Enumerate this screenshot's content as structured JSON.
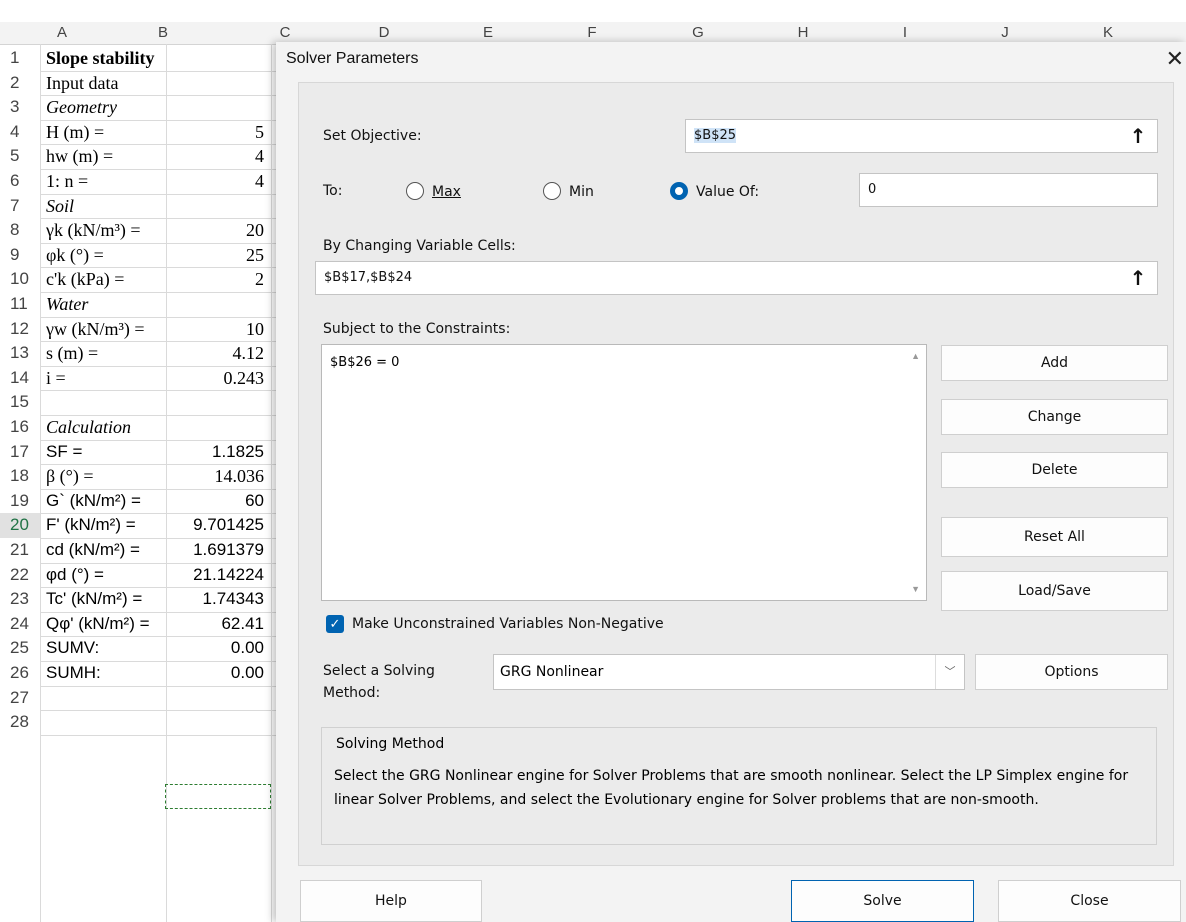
{
  "sheet": {
    "columns": [
      "A",
      "B",
      "C",
      "D",
      "E",
      "F",
      "G",
      "H",
      "I",
      "J",
      "K"
    ],
    "rows": [
      {
        "n": "1",
        "a": "Slope stability",
        "b": "",
        "style": "bold"
      },
      {
        "n": "2",
        "a": "Input data",
        "b": ""
      },
      {
        "n": "3",
        "a": "Geometry",
        "b": "",
        "style": "ital"
      },
      {
        "n": "4",
        "a": "H (m) =",
        "b": "5"
      },
      {
        "n": "5",
        "a": "hw (m) =",
        "b": "4"
      },
      {
        "n": "6",
        "a": "1: n =",
        "b": "4"
      },
      {
        "n": "7",
        "a": "Soil",
        "b": "",
        "style": "ital"
      },
      {
        "n": "8",
        "a": "γk (kN/m³) =",
        "b": "20"
      },
      {
        "n": "9",
        "a": "φk (°) =",
        "b": "25"
      },
      {
        "n": "10",
        "a": "c'k (kPa) =",
        "b": "2"
      },
      {
        "n": "11",
        "a": "Water",
        "b": "",
        "style": "ital"
      },
      {
        "n": "12",
        "a": "γw (kN/m³) =",
        "b": "10"
      },
      {
        "n": "13",
        "a": "s (m) =",
        "b": "4.12"
      },
      {
        "n": "14",
        "a": "i =",
        "b": "0.243"
      },
      {
        "n": "15",
        "a": "",
        "b": ""
      },
      {
        "n": "16",
        "a": "Calculation",
        "b": "",
        "style": "ital"
      },
      {
        "n": "17",
        "a": "SF =",
        "b": "1.1825",
        "font": "sans"
      },
      {
        "n": "18",
        "a": "β (°) =",
        "b": "14.036"
      },
      {
        "n": "19",
        "a": "G` (kN/m²) =",
        "b": "60",
        "font": "sans"
      },
      {
        "n": "20",
        "a": "F' (kN/m²) =",
        "b": "9.701425",
        "font": "sans"
      },
      {
        "n": "21",
        "a": "cd (kN/m²) =",
        "b": "1.691379",
        "font": "sans"
      },
      {
        "n": "22",
        "a": "φd (°) =",
        "b": "21.14224",
        "font": "sans"
      },
      {
        "n": "23",
        "a": "Tc' (kN/m²) =",
        "b": "1.74343",
        "font": "sans"
      },
      {
        "n": "24",
        "a": "Qφ' (kN/m²) =",
        "b": "62.41",
        "font": "sans"
      },
      {
        "n": "25",
        "a": "SUMV:",
        "b": "0.00",
        "font": "sans"
      },
      {
        "n": "26",
        "a": "SUMH:",
        "b": "0.00",
        "font": "sans"
      },
      {
        "n": "27",
        "a": "",
        "b": ""
      },
      {
        "n": "28",
        "a": "",
        "b": ""
      }
    ],
    "active_row": "20"
  },
  "dialog": {
    "title": "Solver Parameters",
    "close_glyph": "✕",
    "set_objective_label": "Set Objective:",
    "objective_value": "$B$25",
    "to_label": "To:",
    "opt_max": "Max",
    "opt_min": "Min",
    "opt_value_of": "Value Of:",
    "value_of": "0",
    "changing_label": "By Changing Variable Cells:",
    "changing_value": "$B$17,$B$24",
    "constraints_label": "Subject to the Constraints:",
    "constraints": [
      "$B$26 = 0"
    ],
    "buttons": {
      "add": "Add",
      "change": "Change",
      "delete": "Delete",
      "reset": "Reset All",
      "loadsave": "Load/Save"
    },
    "nonneg_label": "Make Unconstrained Variables Non-Negative",
    "method_label": "Select a Solving Method:",
    "method_value": "GRG Nonlinear",
    "options_label": "Options",
    "group_title": "Solving Method",
    "group_text": "Select the GRG Nonlinear engine for Solver Problems that are smooth nonlinear. Select the LP Simplex engine for linear Solver Problems, and select the Evolutionary engine for Solver problems that are non-smooth.",
    "help_label": "Help",
    "solve_label": "Solve",
    "close_label": "Close",
    "ref_icon": "↑"
  }
}
